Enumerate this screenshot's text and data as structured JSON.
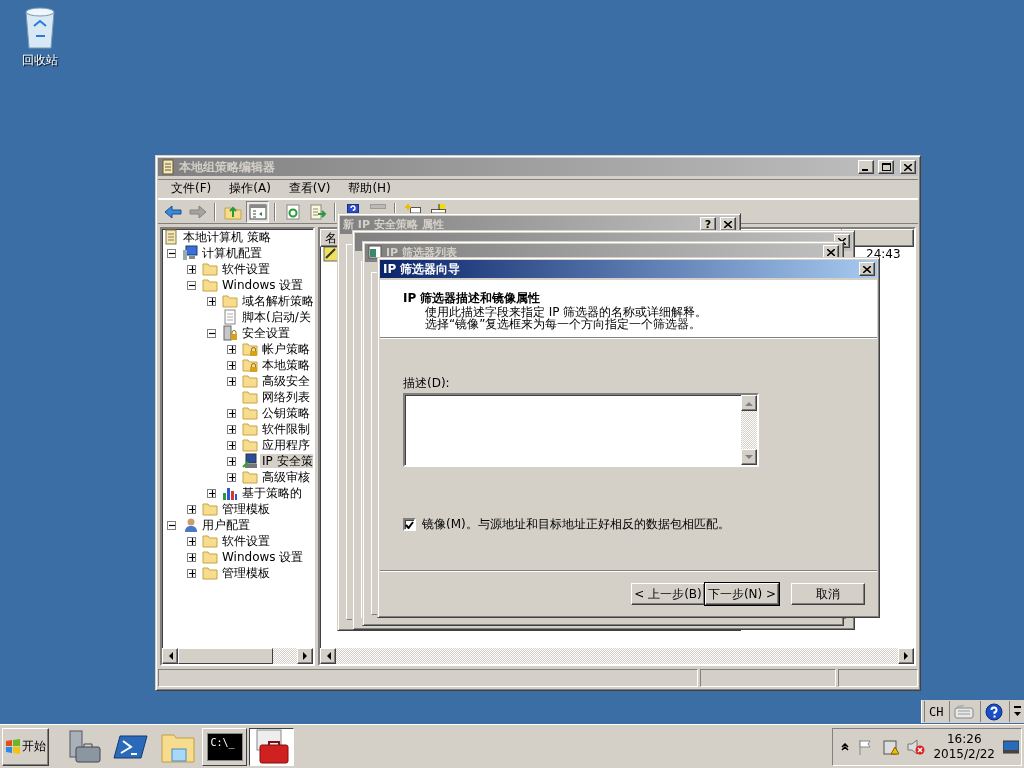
{
  "desktop_icons": [
    {
      "label": "回收站"
    }
  ],
  "main_window": {
    "title": "本地组策略编辑器",
    "active": false,
    "menu": [
      "文件(F)",
      "操作(A)",
      "查看(V)",
      "帮助(H)"
    ],
    "toolbar": [
      [
        {
          "kind": "back",
          "disabled": false,
          "pressed": false
        },
        {
          "kind": "forward",
          "disabled": true,
          "pressed": false
        }
      ],
      [
        {
          "kind": "up",
          "disabled": false,
          "pressed": false
        },
        {
          "kind": "tree-toggle",
          "disabled": false,
          "pressed": true
        }
      ],
      [
        {
          "kind": "refresh",
          "disabled": false,
          "pressed": false
        },
        {
          "kind": "export",
          "disabled": false,
          "pressed": false
        }
      ],
      [
        {
          "kind": "help",
          "disabled": false,
          "pressed": false
        },
        {
          "kind": "bar",
          "disabled": true,
          "pressed": false
        }
      ],
      [
        {
          "kind": "new-item",
          "disabled": false,
          "pressed": false
        },
        {
          "kind": "assign",
          "disabled": false,
          "pressed": false
        }
      ]
    ],
    "tree": [
      {
        "label": "本地计算机 策略",
        "kind": "policy",
        "selected": false,
        "children": [
          {
            "label": "计算机配置",
            "kind": "computer",
            "expandable": true,
            "expanded": true,
            "selected": false,
            "children": [
              {
                "label": "软件设置",
                "kind": "folder",
                "expandable": true,
                "expanded": false,
                "selected": false
              },
              {
                "label": "Windows 设置",
                "kind": "folder",
                "expandable": true,
                "expanded": true,
                "selected": false,
                "children": [
                  {
                    "label": "域名解析策略",
                    "kind": "folder",
                    "expandable": true,
                    "expanded": false,
                    "selected": false
                  },
                  {
                    "label": "脚本(启动/关",
                    "kind": "script",
                    "selected": false
                  },
                  {
                    "label": "安全设置",
                    "kind": "security",
                    "expandable": true,
                    "expanded": true,
                    "selected": false,
                    "children": [
                      {
                        "label": "帐户策略",
                        "kind": "locked-folder",
                        "expandable": true,
                        "expanded": false,
                        "selected": false
                      },
                      {
                        "label": "本地策略",
                        "kind": "locked-folder",
                        "expandable": true,
                        "expanded": false,
                        "selected": false
                      },
                      {
                        "label": "高级安全",
                        "kind": "folder",
                        "expandable": true,
                        "expanded": false,
                        "selected": false
                      },
                      {
                        "label": "网络列表",
                        "kind": "folder",
                        "selected": false
                      },
                      {
                        "label": "公钥策略",
                        "kind": "folder",
                        "expandable": true,
                        "expanded": false,
                        "selected": false
                      },
                      {
                        "label": "软件限制",
                        "kind": "folder",
                        "expandable": true,
                        "expanded": false,
                        "selected": false
                      },
                      {
                        "label": "应用程序",
                        "kind": "folder",
                        "expandable": true,
                        "expanded": false,
                        "selected": false
                      },
                      {
                        "label": "IP 安全策",
                        "kind": "ip-security",
                        "expandable": true,
                        "expanded": false,
                        "selected": true
                      },
                      {
                        "label": "高级审核",
                        "kind": "folder",
                        "expandable": true,
                        "expanded": false,
                        "selected": false
                      }
                    ]
                  },
                  {
                    "label": "基于策略的",
                    "kind": "chart",
                    "expandable": true,
                    "expanded": false,
                    "selected": false
                  }
                ]
              },
              {
                "label": "管理模板",
                "kind": "folder",
                "expandable": true,
                "expanded": false,
                "selected": false
              }
            ]
          },
          {
            "label": "用户配置",
            "kind": "user",
            "expandable": true,
            "expanded": true,
            "selected": false,
            "children": [
              {
                "label": "软件设置",
                "kind": "folder",
                "expandable": true,
                "expanded": false,
                "selected": false
              },
              {
                "label": "Windows 设置",
                "kind": "folder",
                "expandable": true,
                "expanded": false,
                "selected": false
              },
              {
                "label": "管理模板",
                "kind": "folder",
                "expandable": true,
                "expanded": false,
                "selected": false
              }
            ]
          }
        ]
      }
    ],
    "right_pane": {
      "columns": [
        "名"
      ],
      "rows": [
        {
          "cells": [
            "24:43"
          ]
        }
      ]
    }
  },
  "dialogs": [
    {
      "title": "新 IP 安全策略 属性",
      "active": false,
      "help_label": "?"
    },
    {
      "active": false
    },
    {
      "title": "IP 筛选器列表",
      "active": false
    }
  ],
  "wizard": {
    "title": "IP 筛选器向导",
    "active": true,
    "heading": "IP 筛选器描述和镜像属性",
    "description": [
      "使用此描述字段来指定 IP 筛选器的名称或详细解释。",
      "选择“镜像”复选框来为每一个方向指定一个筛选器。"
    ],
    "field_label": "描述(D):",
    "mirror": {
      "label": "镜像(M)。与源地址和目标地址正好相反的数据包相匹配。",
      "checked": true
    },
    "buttons": [
      {
        "label": "< 上一步(B)",
        "default": false
      },
      {
        "label": "下一步(N) >",
        "default": true
      },
      {
        "label": "取消",
        "default": false
      }
    ]
  },
  "language_bar": {
    "label": "CH"
  },
  "taskbar": {
    "start": "开始",
    "apps": [
      {
        "kind": "server-manager",
        "open": false,
        "active": false
      },
      {
        "kind": "powershell",
        "open": false,
        "active": false
      },
      {
        "kind": "explorer",
        "open": false,
        "active": false
      },
      {
        "kind": "cmd",
        "open": true,
        "active": false,
        "icon_text": "C:\\_"
      },
      {
        "kind": "toolbox",
        "open": true,
        "active": true
      }
    ],
    "clock": {
      "time": "16:26",
      "date": "2015/2/22"
    }
  }
}
